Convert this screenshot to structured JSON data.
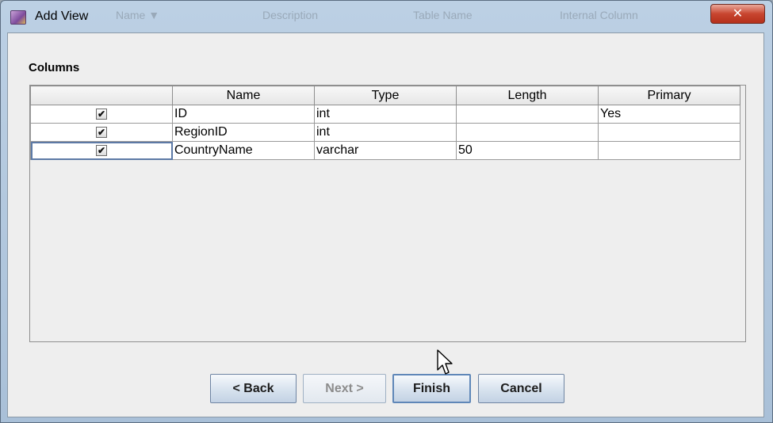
{
  "window": {
    "title": "Add View",
    "close_glyph": "✕",
    "background_ghost_headers": [
      "Name ▼",
      "Description",
      "Table Name",
      "Internal Column"
    ]
  },
  "section": {
    "title": "Columns"
  },
  "table": {
    "headers": [
      "",
      "Name",
      "Type",
      "Length",
      "Primary"
    ],
    "rows": [
      {
        "checked": "✔",
        "name": "ID",
        "type": "int",
        "length": "",
        "primary": "Yes"
      },
      {
        "checked": "✔",
        "name": "RegionID",
        "type": "int",
        "length": "",
        "primary": ""
      },
      {
        "checked": "✔",
        "name": "CountryName",
        "type": "varchar",
        "length": "50",
        "primary": ""
      }
    ]
  },
  "buttons": {
    "back": "< Back",
    "next": "Next >",
    "finish": "Finish",
    "cancel": "Cancel"
  },
  "icons": {
    "app": "app-icon",
    "close": "close-icon",
    "cursor": "mouse-pointer-icon",
    "checkbox": "checkbox-checked-icon"
  }
}
